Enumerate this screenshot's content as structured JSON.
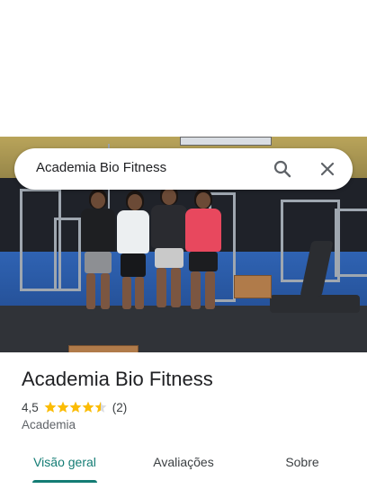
{
  "search": {
    "query": "Academia Bio Fitness"
  },
  "place": {
    "name": "Academia Bio Fitness",
    "rating": "4,5",
    "rating_value": 4.5,
    "rating_max": 5,
    "review_count": "(2)",
    "category": "Academia"
  },
  "tabs": [
    {
      "label": "Visão geral",
      "active": true
    },
    {
      "label": "Avaliações",
      "active": false
    },
    {
      "label": "Sobre",
      "active": false
    }
  ],
  "colors": {
    "accent": "#137c74",
    "star": "#fbbc04",
    "star_empty": "#dadce0"
  },
  "icons": {
    "search": "search-icon",
    "close": "close-icon",
    "star": "star-icon"
  }
}
